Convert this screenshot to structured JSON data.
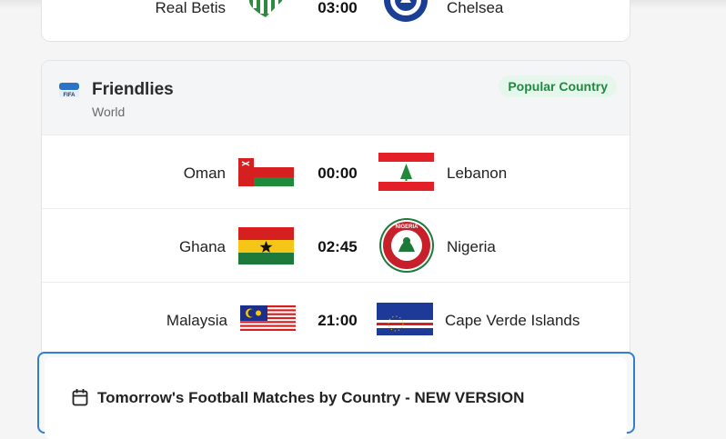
{
  "previous_match": {
    "home": "Real Betis",
    "time": "03:00",
    "away": "Chelsea"
  },
  "league": {
    "name": "Friendlies",
    "region": "World",
    "badge": "Popular Country",
    "logo_text": "FIFA"
  },
  "matches": [
    {
      "home": "Oman",
      "time": "00:00",
      "away": "Lebanon"
    },
    {
      "home": "Ghana",
      "time": "02:45",
      "away": "Nigeria"
    },
    {
      "home": "Malaysia",
      "time": "21:00",
      "away": "Cape Verde Islands"
    }
  ],
  "nigeria_crest_text": "NIGERIA",
  "chelsea_crest_text": "FOOTBALL CLUB",
  "bottom_section": {
    "title": "Tomorrow's Football Matches by Country - NEW VERSION"
  },
  "colors": {
    "badge_bg": "#e5f7ea",
    "badge_text": "#1e8a44",
    "focus_border": "#2f7fd6"
  }
}
